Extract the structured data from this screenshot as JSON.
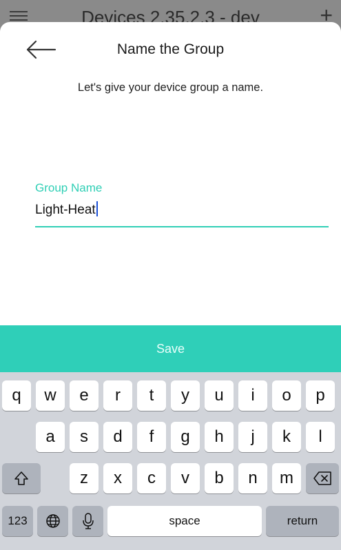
{
  "background_app": {
    "title": "Devices 2.35.2.3 - dev"
  },
  "sheet": {
    "title": "Name the Group",
    "subtitle": "Let's give your device group a name.",
    "field": {
      "label": "Group Name",
      "value": "Light-Heat"
    },
    "save_label": "Save"
  },
  "keyboard": {
    "row1": [
      "q",
      "w",
      "e",
      "r",
      "t",
      "y",
      "u",
      "i",
      "o",
      "p"
    ],
    "row2": [
      "a",
      "s",
      "d",
      "f",
      "g",
      "h",
      "j",
      "k",
      "l"
    ],
    "row3": [
      "z",
      "x",
      "c",
      "v",
      "b",
      "n",
      "m"
    ],
    "numbers_label": "123",
    "space_label": "space",
    "return_label": "return"
  },
  "colors": {
    "accent": "#2fcfb5",
    "keyboard_bg": "#d1d4da",
    "key_dark": "#aeb3bc"
  }
}
